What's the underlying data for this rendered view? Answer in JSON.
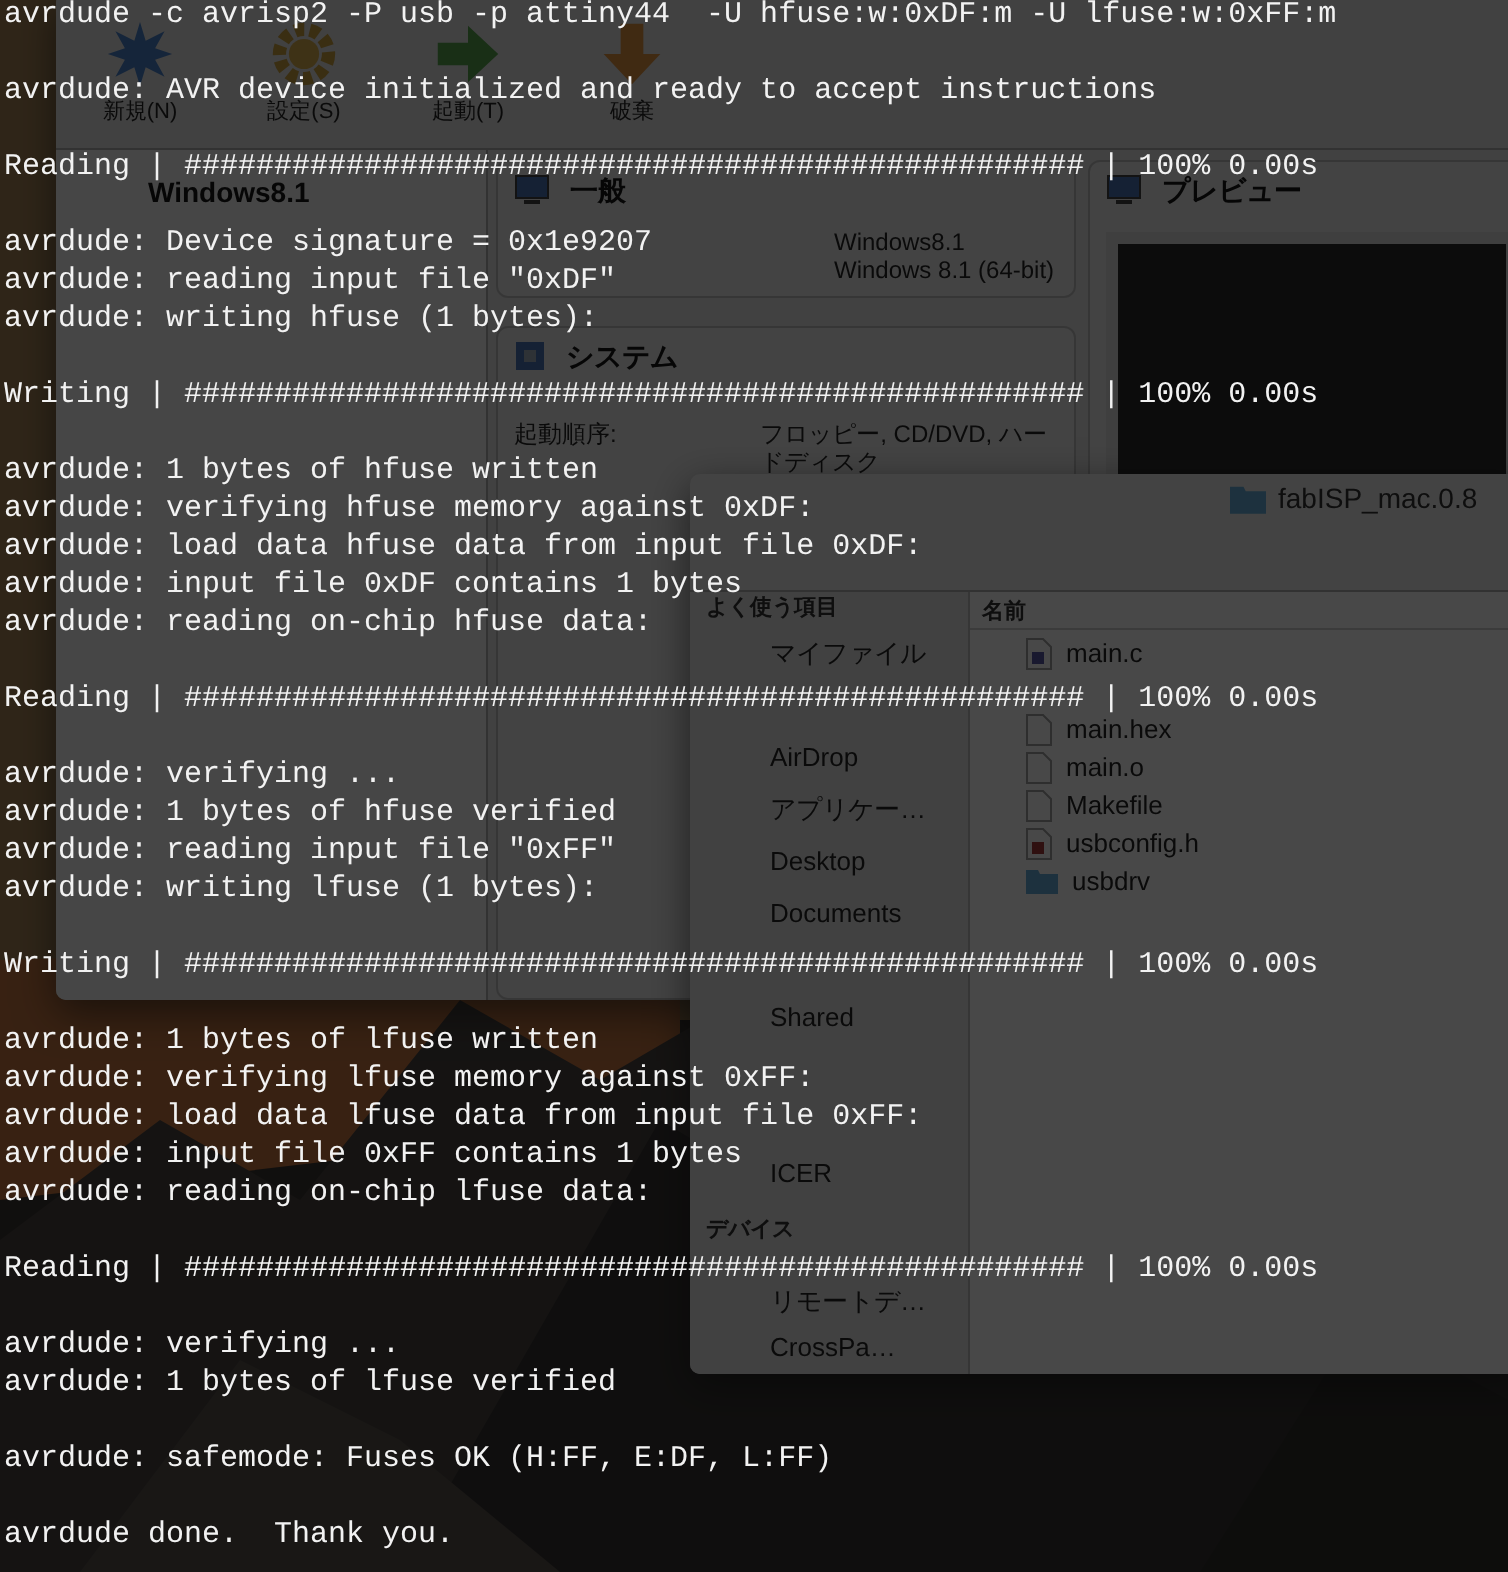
{
  "terminal": {
    "blocks": [
      [
        "avrdude -c avrisp2 -P usb -p attiny44  -U hfuse:w:0xDF:m -U lfuse:w:0xFF:m"
      ],
      [
        "avrdude: AVR device initialized and ready to accept instructions"
      ],
      [
        "Reading | ################################################## | 100% 0.00s"
      ],
      [
        "avrdude: Device signature = 0x1e9207",
        "avrdude: reading input file \"0xDF\"",
        "avrdude: writing hfuse (1 bytes):"
      ],
      [
        "Writing | ################################################## | 100% 0.00s"
      ],
      [
        "avrdude: 1 bytes of hfuse written",
        "avrdude: verifying hfuse memory against 0xDF:",
        "avrdude: load data hfuse data from input file 0xDF:",
        "avrdude: input file 0xDF contains 1 bytes",
        "avrdude: reading on-chip hfuse data:"
      ],
      [
        "Reading | ################################################## | 100% 0.00s"
      ],
      [
        "avrdude: verifying ...",
        "avrdude: 1 bytes of hfuse verified",
        "avrdude: reading input file \"0xFF\"",
        "avrdude: writing lfuse (1 bytes):"
      ],
      [
        "Writing | ################################################## | 100% 0.00s"
      ],
      [
        "avrdude: 1 bytes of lfuse written",
        "avrdude: verifying lfuse memory against 0xFF:",
        "avrdude: load data lfuse data from input file 0xFF:",
        "avrdude: input file 0xFF contains 1 bytes",
        "avrdude: reading on-chip lfuse data:"
      ],
      [
        "Reading | ################################################## | 100% 0.00s"
      ],
      [
        "avrdude: verifying ...",
        "avrdude: 1 bytes of lfuse verified"
      ],
      [
        "avrdude: safemode: Fuses OK (H:FF, E:DF, L:FF)"
      ],
      [
        "avrdude done.  Thank you."
      ]
    ]
  },
  "virtualbox": {
    "toolbar": [
      {
        "label": "新規(N)",
        "kind": "new"
      },
      {
        "label": "設定(S)",
        "kind": "settings"
      },
      {
        "label": "起動(T)",
        "kind": "start"
      },
      {
        "label": "破棄",
        "kind": "discard"
      }
    ],
    "vm": {
      "name": "Windows8.1"
    },
    "general": {
      "title": "一般",
      "values": [
        "Windows8.1",
        "Windows 8.1 (64-bit)"
      ]
    },
    "system": {
      "title": "システム",
      "label": "起動順序:",
      "value": "フロッピー, CD/DVD, ハードディスク"
    },
    "preview": {
      "title": "プレビュー"
    }
  },
  "finder": {
    "title": "fabISP_mac.0.8",
    "favorites_heading": "よく使う項目",
    "favorites": [
      "マイファイル",
      "AirDrop",
      "アプリケー…",
      "Desktop",
      "Documents",
      "Shared",
      "ICER"
    ],
    "devices_heading": "デバイス",
    "devices": [
      "リモートデ…",
      "CrossPa…"
    ],
    "column": "名前",
    "files": [
      {
        "name": "main.c",
        "kind": "c"
      },
      {
        "name": "main.hex",
        "kind": "plain"
      },
      {
        "name": "main.o",
        "kind": "plain"
      },
      {
        "name": "Makefile",
        "kind": "plain"
      },
      {
        "name": "usbconfig.h",
        "kind": "h"
      },
      {
        "name": "usbdrv",
        "kind": "folder"
      }
    ]
  }
}
